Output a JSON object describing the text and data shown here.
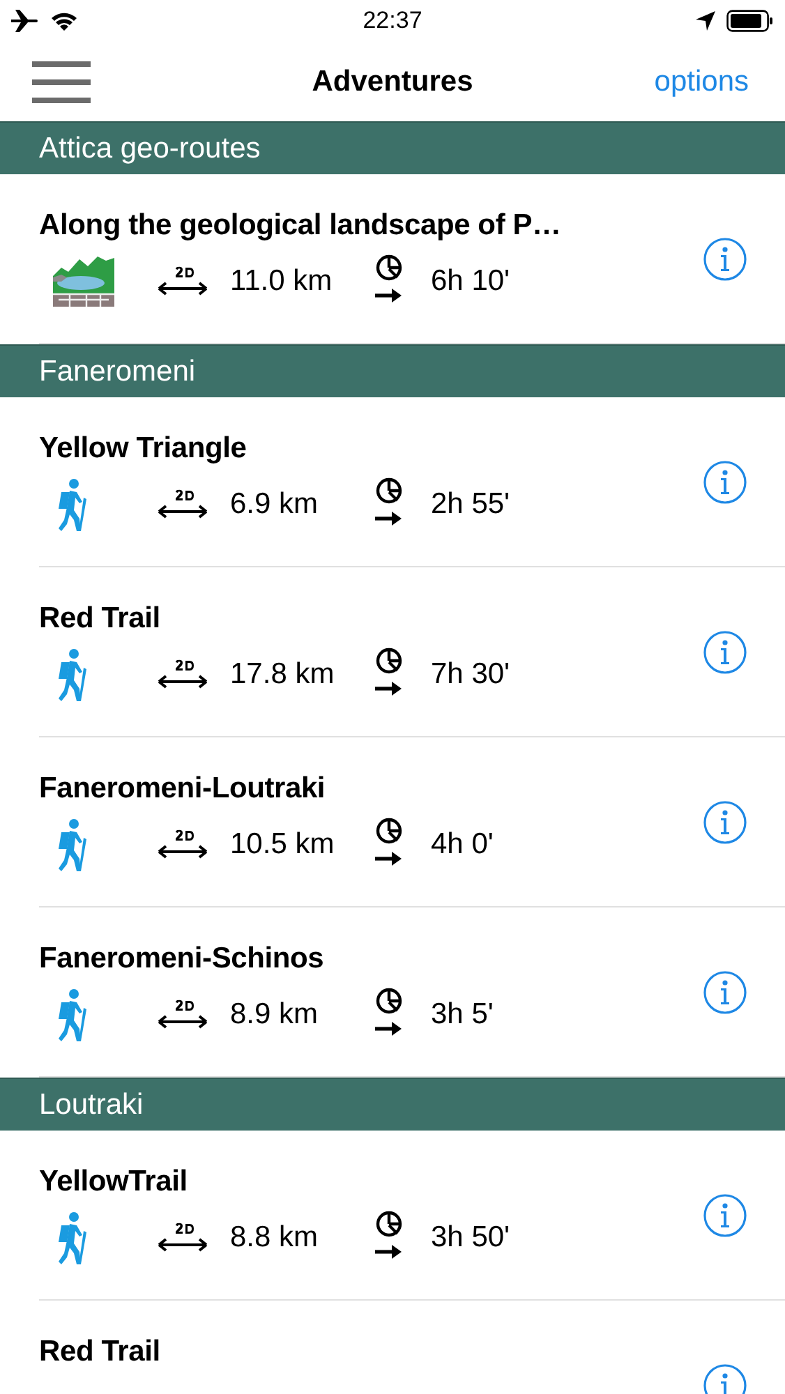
{
  "status_bar": {
    "time": "22:37"
  },
  "nav": {
    "title": "Adventures",
    "action": "options"
  },
  "sections": [
    {
      "title": "Attica geo-routes",
      "items": [
        {
          "title": "Along the geological landscape of P…",
          "kind": "geo",
          "distance": "11.0 km",
          "duration": "6h 10'"
        }
      ]
    },
    {
      "title": "Faneromeni",
      "items": [
        {
          "title": "Yellow Triangle",
          "kind": "hike",
          "distance": "6.9 km",
          "duration": "2h 55'"
        },
        {
          "title": "Red Trail",
          "kind": "hike",
          "distance": "17.8 km",
          "duration": "7h 30'"
        },
        {
          "title": "Faneromeni-Loutraki",
          "kind": "hike",
          "distance": "10.5 km",
          "duration": "4h 0'"
        },
        {
          "title": "Faneromeni-Schinos",
          "kind": "hike",
          "distance": "8.9 km",
          "duration": "3h 5'"
        }
      ]
    },
    {
      "title": "Loutraki",
      "items": [
        {
          "title": "YellowTrail",
          "kind": "hike",
          "distance": "8.8 km",
          "duration": "3h 50'"
        },
        {
          "title": "Red Trail"
        }
      ]
    }
  ]
}
